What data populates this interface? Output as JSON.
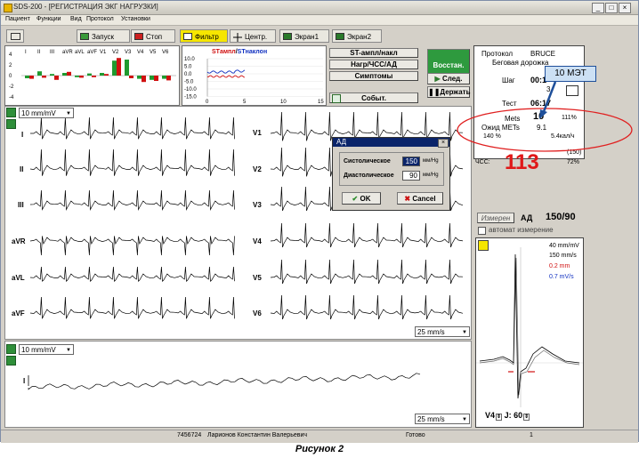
{
  "window": {
    "title": "SDS-200 - [РЕГИСТРАЦИЯ ЭКГ НАГРУЗКИ]",
    "controls": [
      "_",
      "□",
      "×"
    ]
  },
  "menu": [
    "Пациент",
    "Функции",
    "Вид",
    "Протокол",
    "Установки"
  ],
  "toolbar": {
    "start": "Запуск",
    "stop": "Стоп",
    "filter": "Фильтр",
    "center": "Центр.",
    "screen1": "Экран1",
    "screen2": "Экран2"
  },
  "bar_chart": {
    "leads": [
      "I",
      "II",
      "III",
      "aVR",
      "aVL",
      "aVF",
      "V1",
      "V2",
      "V3",
      "V4",
      "V5",
      "V6"
    ],
    "y_ticks": [
      "4",
      "2",
      "0",
      "-2",
      "-4"
    ],
    "green_values": [
      -0.5,
      0.8,
      0.3,
      0.5,
      -0.3,
      0.4,
      0.5,
      2.8,
      3.0,
      -0.6,
      -0.8,
      -0.6
    ],
    "red_values": [
      -0.6,
      -0.4,
      -0.8,
      0.7,
      -0.4,
      -0.3,
      0.3,
      3.3,
      -0.5,
      -1.2,
      -1.0,
      -0.9
    ]
  },
  "st_trend": {
    "title_a": "STампл",
    "title_sep": "/",
    "title_b": "STнаклон",
    "y_ticks": [
      "10.0",
      "5.0",
      "0.0",
      "-5.0",
      "-10.0",
      "-15.0"
    ],
    "x_ticks": [
      "0",
      "5",
      "10",
      "15"
    ]
  },
  "right_buttons": {
    "st": "ST-ампл/накл",
    "load": "Нагр/ЧСС/АД",
    "symptoms": "Симптомы",
    "event": "Событ.",
    "recover": "Восстан.",
    "next": "След.",
    "hold": "Держать"
  },
  "protocol": {
    "label": "Протокол",
    "name": "BRUCE",
    "type": "Беговая дорожка",
    "step_label": "Шаг",
    "step_value": "00:1",
    "step_num": "3",
    "test_label": "Тест",
    "test_value": "06:17"
  },
  "mets": {
    "mets_label": "Mets",
    "mets_value": "10",
    "mets_pct": "111%",
    "expected_label": "Ожид METs",
    "expected_value": "9.1",
    "pct": "140 %",
    "rate": "5.4кал/ч"
  },
  "hr": {
    "label": "ЧСС:",
    "value": "113",
    "extra1": "(150)",
    "extra2": "72%"
  },
  "bp": {
    "measure_button": "Измерен",
    "label": "АД",
    "value": "150/90",
    "auto_label": "автомат измерение"
  },
  "complex": {
    "scale1": "40 mm/mV",
    "scale2": "150 mm/s",
    "red_text": "0.2 mm",
    "blue_text": "0.7 mV/s",
    "lead": "V4",
    "j_label": "J: 60"
  },
  "ecg_top": {
    "gain": "10 mm/mV",
    "speed": "25 mm/s",
    "left_leads": [
      "I",
      "II",
      "III",
      "aVR",
      "aVL",
      "aVF"
    ],
    "right_leads": [
      "V1",
      "V2",
      "V3",
      "V4",
      "V5",
      "V6"
    ]
  },
  "ecg_bottom": {
    "gain": "10 mm/mV",
    "speed": "25 mm/s",
    "lead": "I"
  },
  "dialog": {
    "title": "АД",
    "systolic_label": "Систолическое",
    "systolic_value": "150",
    "diastolic_label": "Диастолическое",
    "diastolic_value": "90",
    "unit1": "мм/Hg",
    "unit2": "мм/Hg",
    "ok": "OK",
    "cancel": "Cancel"
  },
  "callout": "10 МЭТ",
  "status": {
    "id": "7456724",
    "patient": "Ларионов Константин Валерьевич",
    "state": "Готово",
    "page": "1"
  },
  "caption": "Рисунок 2"
}
